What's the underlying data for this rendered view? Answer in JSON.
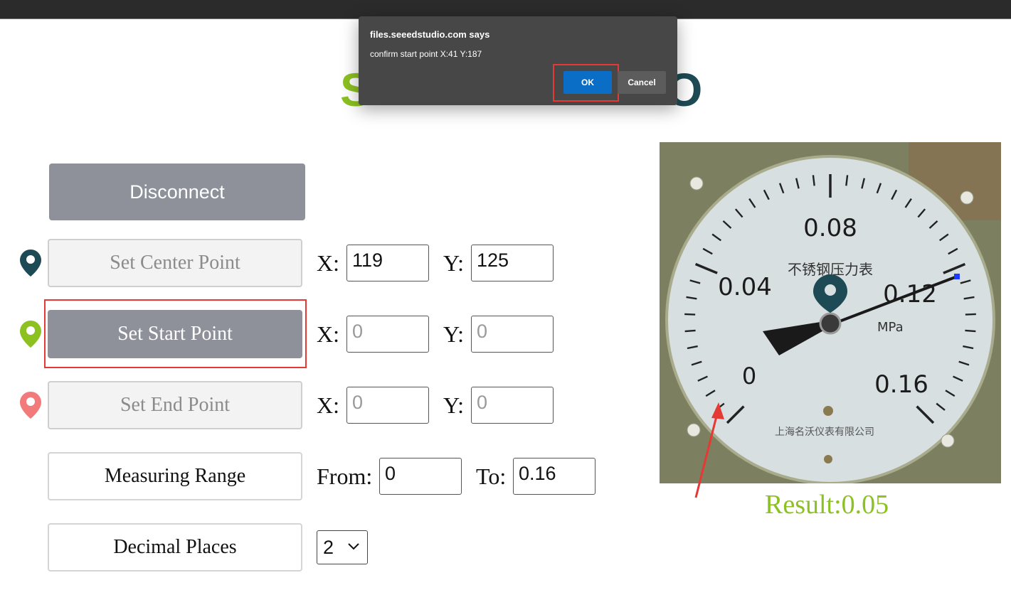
{
  "dialog": {
    "title": "files.seeedstudio.com says",
    "message": "confirm start point X:41 Y:187",
    "ok_label": "OK",
    "cancel_label": "Cancel"
  },
  "logo": {
    "left_fragment": "S",
    "right_fragment": "O"
  },
  "controls": {
    "disconnect_label": "Disconnect",
    "center": {
      "label": "Set Center Point",
      "x_label": "X:",
      "y_label": "Y:",
      "x_value": "119",
      "y_value": "125"
    },
    "start": {
      "label": "Set Start Point",
      "x_label": "X:",
      "y_label": "Y:",
      "x_placeholder": "0",
      "y_placeholder": "0"
    },
    "end": {
      "label": "Set End Point",
      "x_label": "X:",
      "y_label": "Y:",
      "x_placeholder": "0",
      "y_placeholder": "0"
    },
    "range": {
      "label": "Measuring Range",
      "from_label": "From:",
      "to_label": "To:",
      "from_value": "0",
      "to_value": "0.16"
    },
    "decimal": {
      "label": "Decimal Places",
      "selected": "2"
    }
  },
  "gauge": {
    "labels": {
      "top": "0.08",
      "left": "0.04",
      "right": "0.12",
      "zero": "0",
      "max": "0.16",
      "unit": "MPa",
      "title": "不锈钢压力表",
      "maker": "上海名沃仪表有限公司"
    }
  },
  "result": {
    "text": "Result:0.05"
  },
  "colors": {
    "accent_green": "#8cc121",
    "dark_teal": "#1e4a55",
    "start_pin": "#8cc121",
    "end_pin": "#f27a7a",
    "button_gray": "#8e9199",
    "ok_blue": "#0a6ec7",
    "highlight_red": "#e53935"
  },
  "icons": {
    "center_pin": "map-pin-icon",
    "start_pin": "map-pin-icon",
    "end_pin": "map-pin-icon",
    "select_chevron": "chevron-down-icon",
    "annotation_arrow": "arrow-icon"
  }
}
